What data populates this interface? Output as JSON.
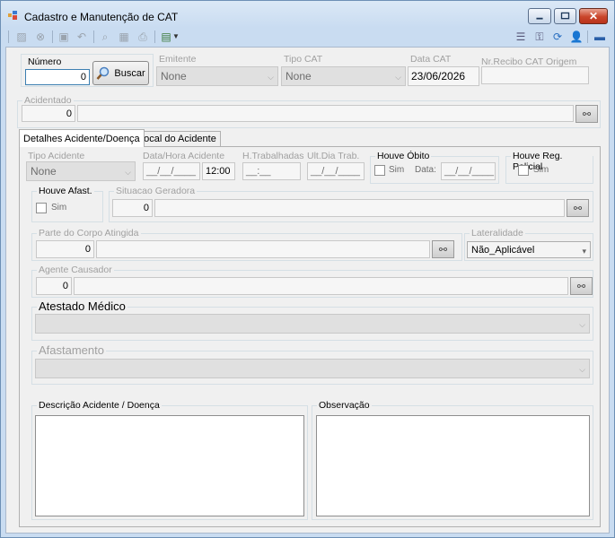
{
  "window": {
    "title": "Cadastro e Manutenção de CAT",
    "minimize": "–",
    "maximize": "□",
    "close": "✕"
  },
  "toolbar": {
    "icons": [
      "new-icon",
      "delete-icon",
      "save-icon",
      "undo-icon",
      "search-icon",
      "grid-icon",
      "print-icon",
      "report-icon",
      "dropdown-arrow-icon"
    ],
    "right_icons": [
      "list-icon",
      "keys-icon",
      "refresh-icon",
      "user-icon",
      "exit-icon"
    ]
  },
  "header": {
    "numero_label": "Número",
    "numero_value": "0",
    "buscar_label": "Buscar",
    "emitente_label": "Emitente",
    "emitente_value": "None",
    "tipo_cat_label": "Tipo CAT",
    "tipo_cat_value": "None",
    "data_cat_label": "Data CAT",
    "data_cat_value": "23/06/2026",
    "recibo_label": "Nr.Recibo CAT Origem",
    "recibo_value": ""
  },
  "acidentado": {
    "label": "Acidentado",
    "code": "0",
    "name": ""
  },
  "tabs": [
    {
      "label": "Detalhes Acidente/Doença",
      "active": true
    },
    {
      "label": "Local do Acidente",
      "active": false
    }
  ],
  "details": {
    "tipo_acidente_label": "Tipo Acidente",
    "tipo_acidente_value": "None",
    "data_hora_label": "Data/Hora Acidente",
    "data_value": "__/__/____",
    "hora_value": "12:00",
    "h_trab_label": "H.Trabalhadas",
    "h_trab_value": "__:__",
    "ult_dia_label": "Ult.Dia Trab.",
    "ult_dia_value": "__/__/____",
    "obito_label": "Houve Óbito",
    "obito_sim": "Sim",
    "obito_data_label": "Data:",
    "obito_data_value": "__/__/____",
    "reg_policial_label": "Houve Reg. Policial",
    "reg_policial_sim": "Sim",
    "afast_label": "Houve Afast.",
    "afast_sim": "Sim",
    "situacao_label": "Situacao Geradora",
    "situacao_code": "0",
    "parte_corpo_label": "Parte do Corpo Atingida",
    "parte_corpo_code": "0",
    "lateralidade_label": "Lateralidade",
    "lateralidade_value": "Não_Aplicável",
    "agente_label": "Agente Causador",
    "agente_code": "0",
    "atestado_label": "Atestado Médico",
    "afastamento_label": "Afastamento",
    "descricao_label": "Descrição Acidente / Doença",
    "observacao_label": "Observação"
  }
}
